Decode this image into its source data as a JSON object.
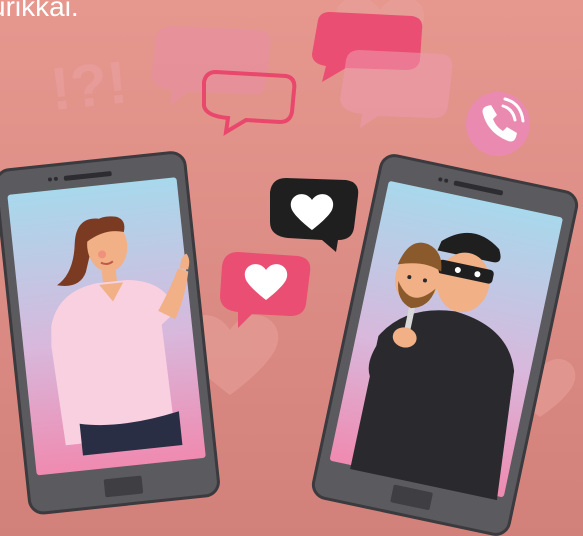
{
  "header": {
    "text": "urikkai."
  },
  "decor": {
    "exclaim_text": "!?!"
  },
  "palette": {
    "background": "#d98a82",
    "bubble_pink": "#ea4e72",
    "bubble_dark": "#1f1f1f",
    "phone_body": "#5b5a5e",
    "skin": "#f1b085",
    "dark_clothes": "#2a2a2e"
  },
  "icons": [
    "phone-call-icon",
    "heart-icon"
  ]
}
